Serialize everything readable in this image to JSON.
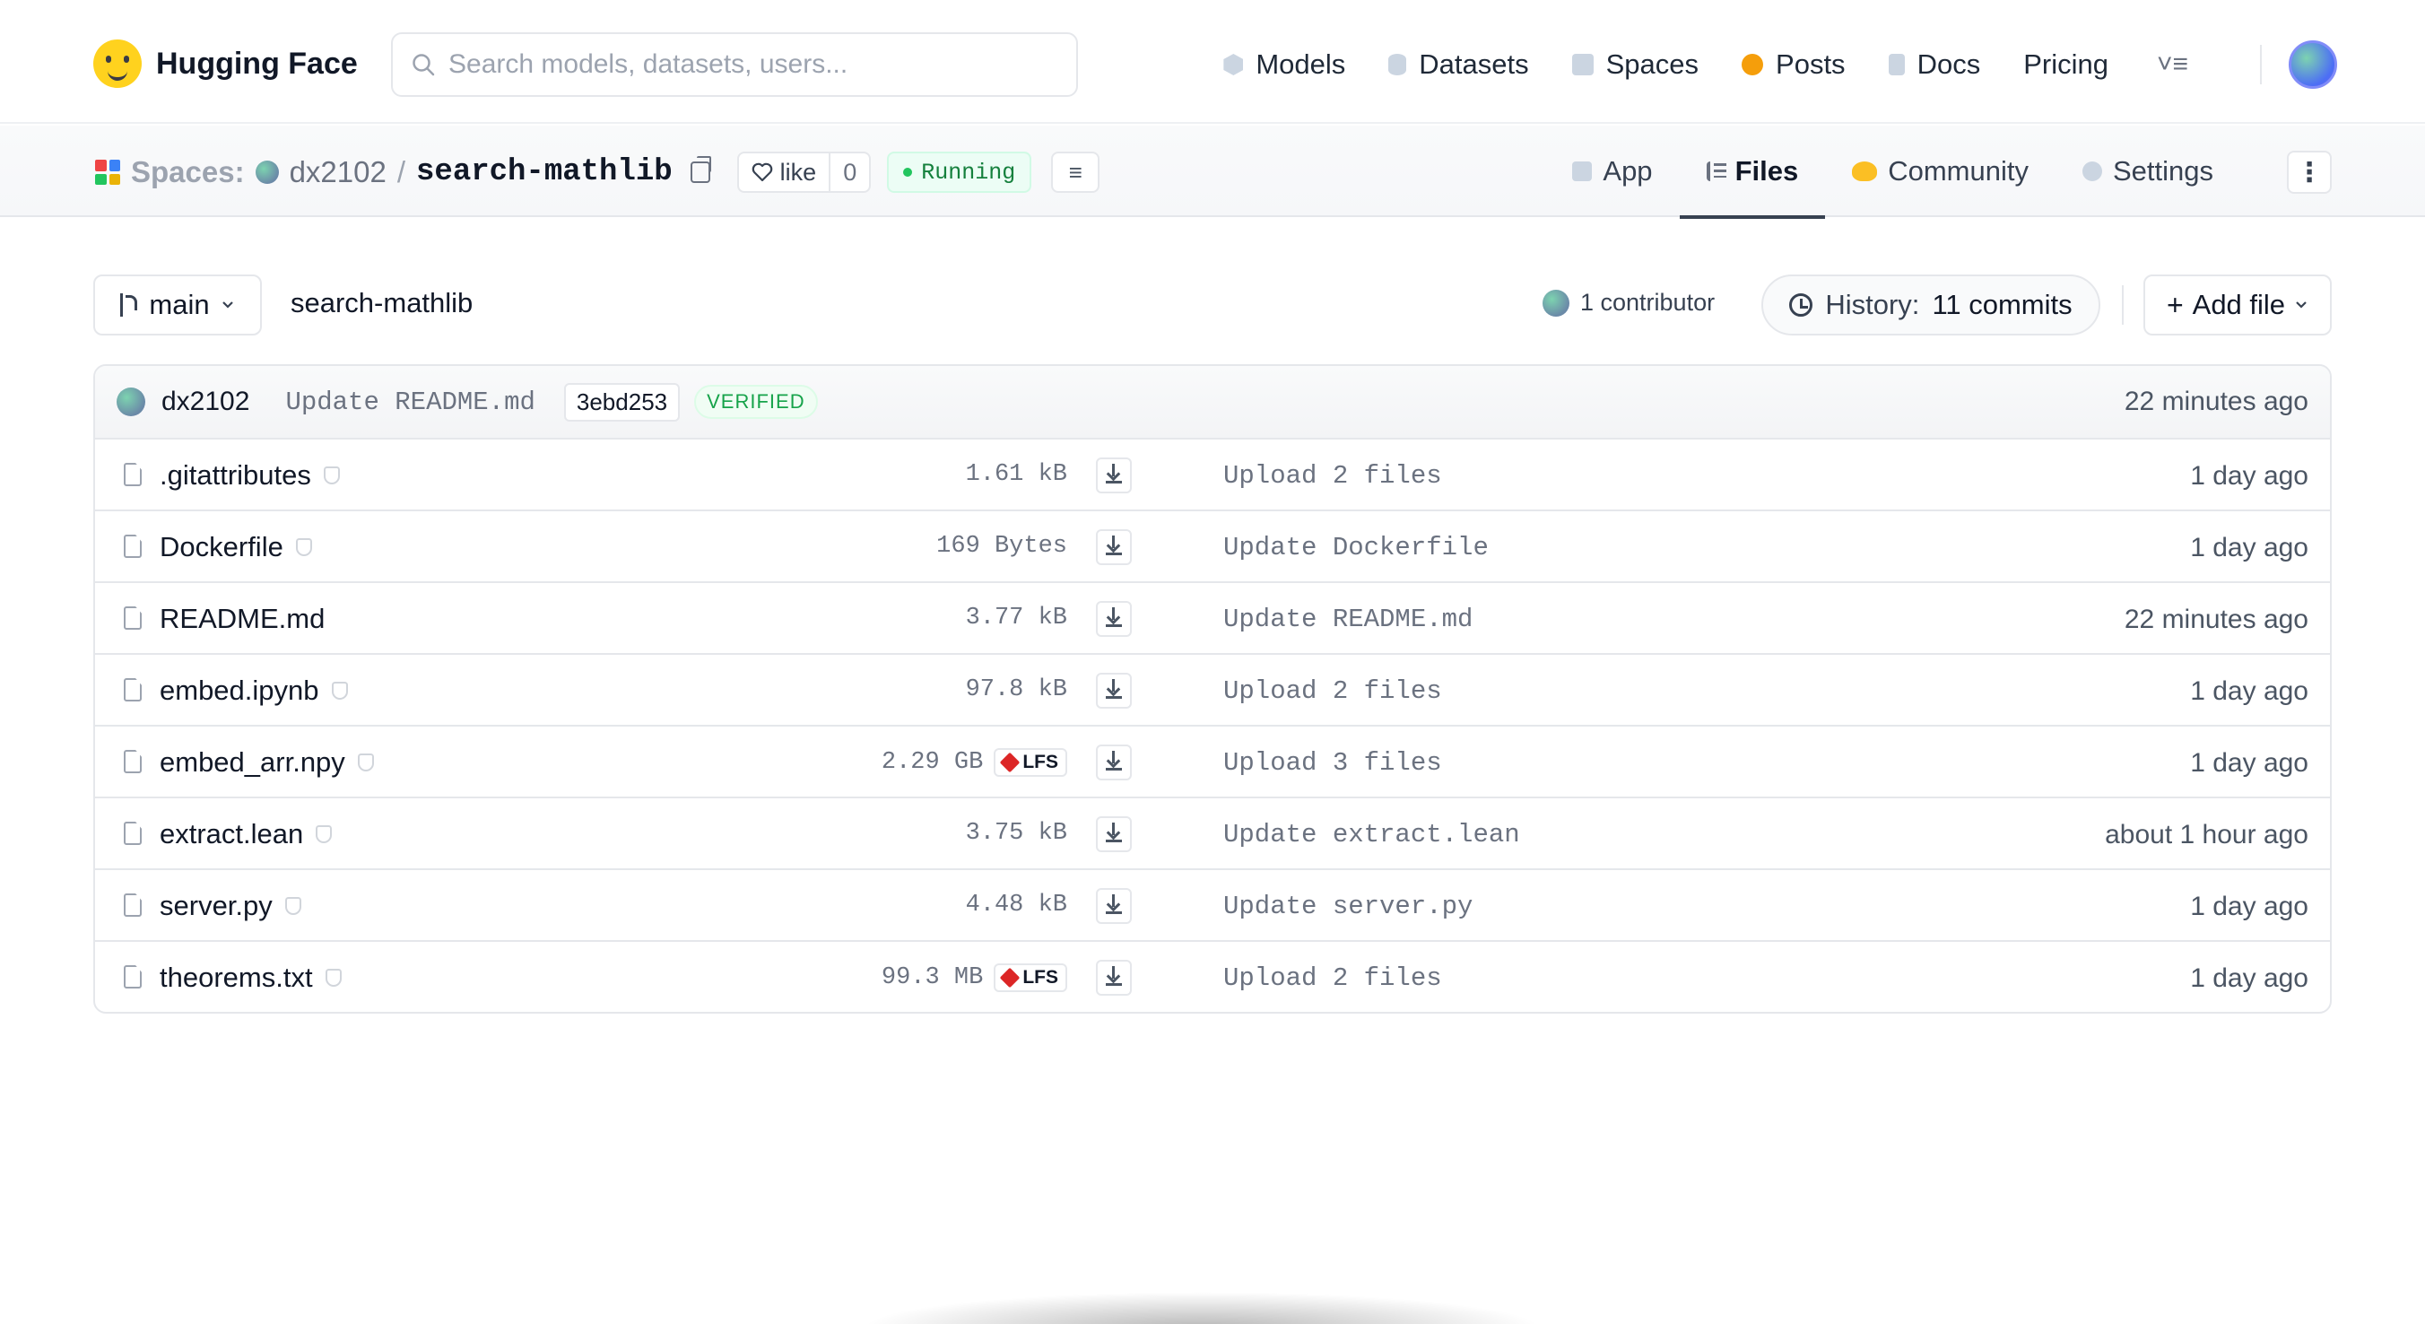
{
  "topnav": {
    "brand": "Hugging Face",
    "search_placeholder": "Search models, datasets, users...",
    "links": [
      {
        "label": "Models",
        "icon": "cube-icon"
      },
      {
        "label": "Datasets",
        "icon": "database-icon"
      },
      {
        "label": "Spaces",
        "icon": "spaces-icon"
      },
      {
        "label": "Posts",
        "icon": "posts-icon"
      },
      {
        "label": "Docs",
        "icon": "docs-icon"
      },
      {
        "label": "Pricing",
        "icon": ""
      }
    ]
  },
  "repo": {
    "section": "Spaces:",
    "owner": "dx2102",
    "separator": "/",
    "name": "search-mathlib",
    "like_label": "like",
    "like_count": "0",
    "status": "Running",
    "status_color": "#16a34a"
  },
  "tabs": [
    {
      "label": "App"
    },
    {
      "label": "Files"
    },
    {
      "label": "Community"
    },
    {
      "label": "Settings"
    }
  ],
  "branchbar": {
    "branch": "main",
    "path": "search-mathlib",
    "contributors": "1 contributor",
    "history_prefix": "History:",
    "history_count": "11 commits",
    "add_file": "Add file"
  },
  "last_commit": {
    "author": "dx2102",
    "message": "Update README.md",
    "hash": "3ebd253",
    "badge": "VERIFIED",
    "time": "22 minutes ago"
  },
  "files": [
    {
      "name": ".gitattributes",
      "size": "1.61 kB",
      "lfs": false,
      "commit": "Upload 2 files",
      "time": "1 day ago",
      "shield": true
    },
    {
      "name": "Dockerfile",
      "size": "169 Bytes",
      "lfs": false,
      "commit": "Update Dockerfile",
      "time": "1 day ago",
      "shield": true
    },
    {
      "name": "README.md",
      "size": "3.77 kB",
      "lfs": false,
      "commit": "Update README.md",
      "time": "22 minutes ago",
      "shield": false
    },
    {
      "name": "embed.ipynb",
      "size": "97.8 kB",
      "lfs": false,
      "commit": "Upload 2 files",
      "time": "1 day ago",
      "shield": true
    },
    {
      "name": "embed_arr.npy",
      "size": "2.29 GB",
      "lfs": true,
      "commit": "Upload 3 files",
      "time": "1 day ago",
      "shield": true
    },
    {
      "name": "extract.lean",
      "size": "3.75 kB",
      "lfs": false,
      "commit": "Update extract.lean",
      "time": "about 1 hour ago",
      "shield": true
    },
    {
      "name": "server.py",
      "size": "4.48 kB",
      "lfs": false,
      "commit": "Update server.py",
      "time": "1 day ago",
      "shield": true
    },
    {
      "name": "theorems.txt",
      "size": "99.3 MB",
      "lfs": true,
      "commit": "Upload 2 files",
      "time": "1 day ago",
      "shield": true
    }
  ],
  "lfs_label": "LFS"
}
